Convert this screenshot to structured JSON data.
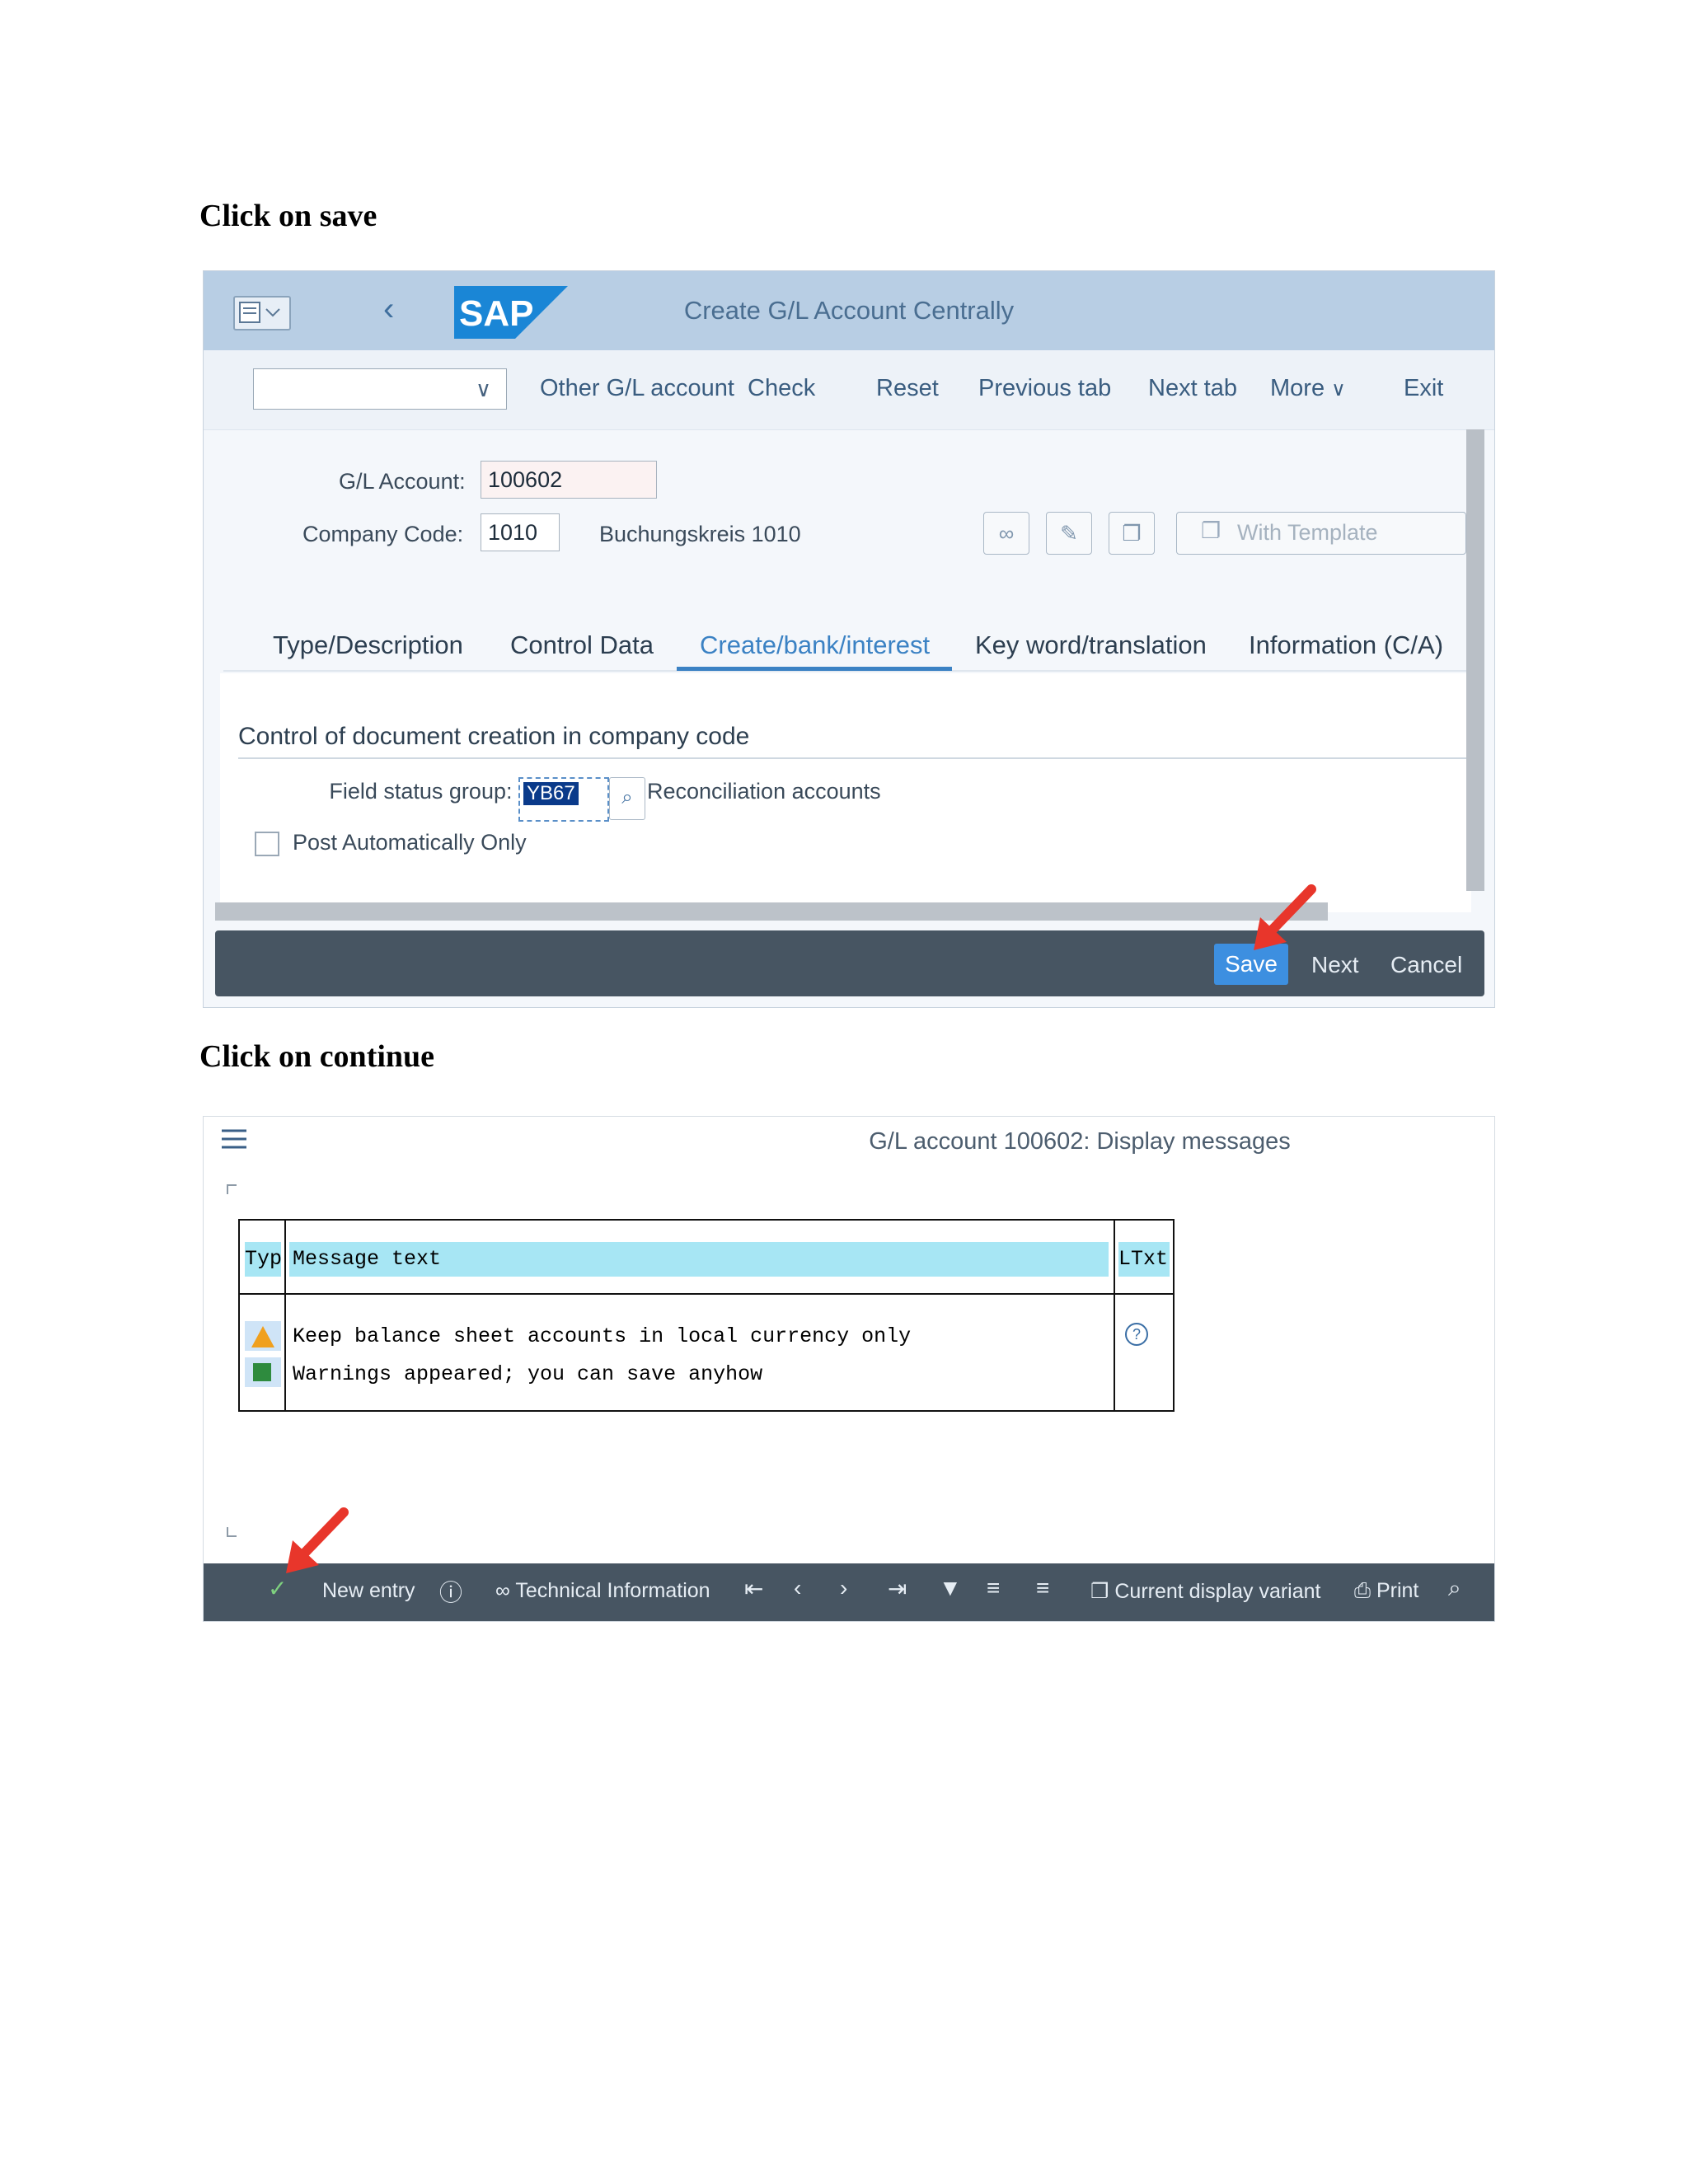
{
  "headings": {
    "save_step": "Click on save",
    "continue_step": "Click on continue"
  },
  "screen1": {
    "window_title": "Create G/L Account Centrally",
    "logo_text": "SAP",
    "toolbar": {
      "dropdown_value": "",
      "items": [
        "Other G/L account",
        "Check",
        "Reset",
        "Previous tab",
        "Next tab",
        "More",
        "Exit"
      ]
    },
    "gl_account_label": "G/L Account:",
    "gl_account_value": "100602",
    "company_code_label": "Company Code:",
    "company_code_value": "1010",
    "company_code_text": "Buchungskreis 1010",
    "with_template_label": "With Template",
    "tabs": [
      "Type/Description",
      "Control Data",
      "Create/bank/interest",
      "Key word/translation",
      "Information (C/A)"
    ],
    "active_tab": "Create/bank/interest",
    "section_title": "Control of document creation in company code",
    "field_status_group_label": "Field status group:",
    "field_status_group_value": "YB67",
    "field_status_group_text": "Reconciliation accounts",
    "post_automatically_label": "Post Automatically Only",
    "post_automatically_checked": false,
    "footer_buttons": [
      "Save",
      "Next",
      "Cancel"
    ],
    "accent_color": "#3d8fe0"
  },
  "screen2": {
    "window_title": "G/L account 100602: Display messages",
    "columns": [
      "Typ",
      "Message text",
      "LTxt"
    ],
    "rows": [
      {
        "type": "warning",
        "text": "Keep balance sheet accounts in local currency only",
        "ltxt_icon": "help-icon"
      },
      {
        "type": "success",
        "text": "Warnings appeared; you can save anyhow",
        "ltxt_icon": ""
      }
    ],
    "toolbar": {
      "new_entry": "New entry",
      "technical_information": "Technical Information",
      "current_display_variant": "Current display variant",
      "print": "Print"
    },
    "status_colors": {
      "warning": "#f0a01e",
      "success": "#2e8b3e"
    }
  }
}
